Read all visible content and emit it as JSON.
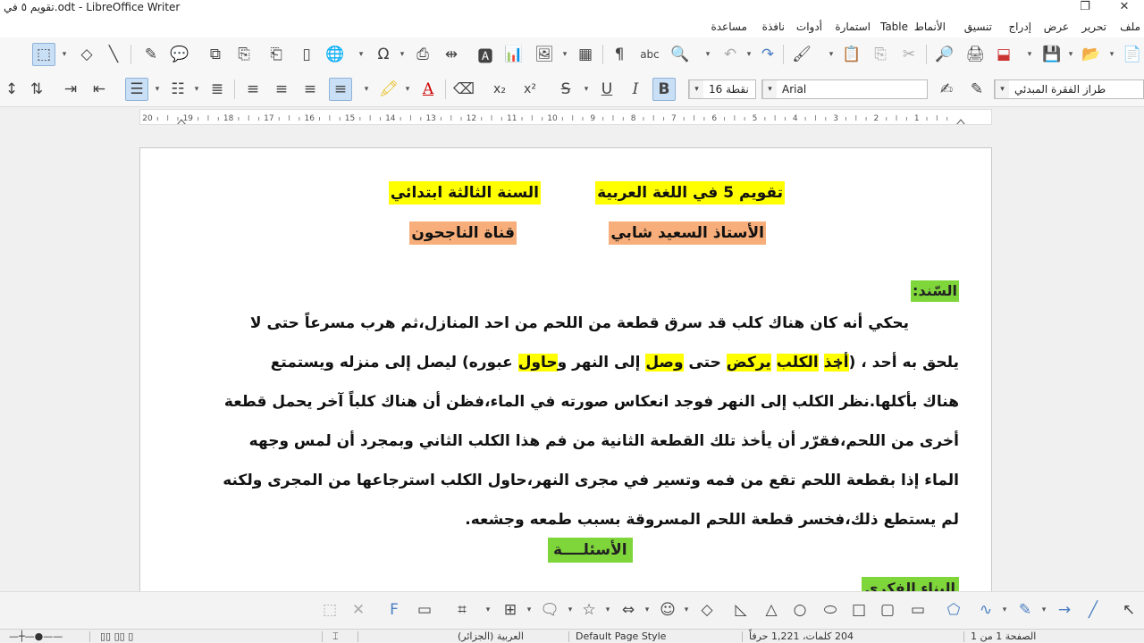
{
  "window": {
    "title": "تقويم ٥ في.odt - LibreOffice Writer",
    "controls": {
      "restore": "❐",
      "close": "✕"
    }
  },
  "menu": {
    "items": [
      "ملف",
      "تحرير",
      "عرض",
      "إدراج",
      "تنسيق",
      "الأنماط",
      "Table",
      "استمارة",
      "أدوات",
      "نافذة",
      "مساعدة"
    ]
  },
  "toolbar": {
    "font_size": "16 نقطة",
    "font_name": "Arial",
    "paragraph_style": "طراز الفقرة المبدئي",
    "active_buttons": [
      "bold",
      "align-right",
      "list"
    ],
    "ruler_numbers": [
      "20",
      "19",
      "18",
      "17",
      "16",
      "15",
      "14",
      "13",
      "12",
      "11",
      "10",
      "9",
      "8",
      "7",
      "6",
      "5",
      "4",
      "3",
      "2",
      "1"
    ]
  },
  "document": {
    "header": {
      "title": "تقويم 5 في اللغة العربية",
      "grade": "السنة الثالثة ابتدائي",
      "teacher": "الأستاذ السعيد شابي",
      "channel": "قناة الناجحون"
    },
    "sanad_label": "السّند:",
    "lines": [
      "يحكي أنه كان هناك كلب قد سرق قطعة من اللحم من احد المنازل،ثم هرب مسرعاً حتى لا",
      "هناك بأكلها.نظر الكلب إلى النهر فوجد انعكاس صورته في الماء،فظن أن هناك كلباً آخر يحمل قطعة",
      "أخرى من اللحم،فقرّر أن يأخذ تلك القطعة الثانية من فم هذا الكلب الثاني وبمجرد أن لمس وجهه",
      "الماء إذا بقطعة اللحم تقع من فمه وتسير في مجرى النهر،حاول الكلب استرجاعها من المجرى ولكنه",
      "لم يستطع ذلك،فخسر قطعة اللحم المسروقة بسبب طمعه وجشعه."
    ],
    "line2_parts": {
      "a": "يلحق به أحد ، (",
      "b": "أخذ",
      "c": " ",
      "d": "الكلب",
      "e": " ",
      "f": "يركض",
      "g": " حتى ",
      "h": "وصل",
      "i": " إلى النهر و",
      "j": "حاول",
      "k": " عبوره) ليصل إلى منزله ويستمتع"
    },
    "questions_label": "الأسئلــــة",
    "next_heading": "البناء الفكري"
  },
  "statusbar": {
    "page": "الصفحة 1 من 1",
    "words": "204 كلمات، 1,221 حرفاً",
    "page_style": "Default Page Style",
    "language": "العربية (الجزائر)"
  },
  "colors": {
    "highlight_yellow": "#ffff00",
    "highlight_orange": "#f7ae7a",
    "highlight_green": "#7fd63b"
  }
}
